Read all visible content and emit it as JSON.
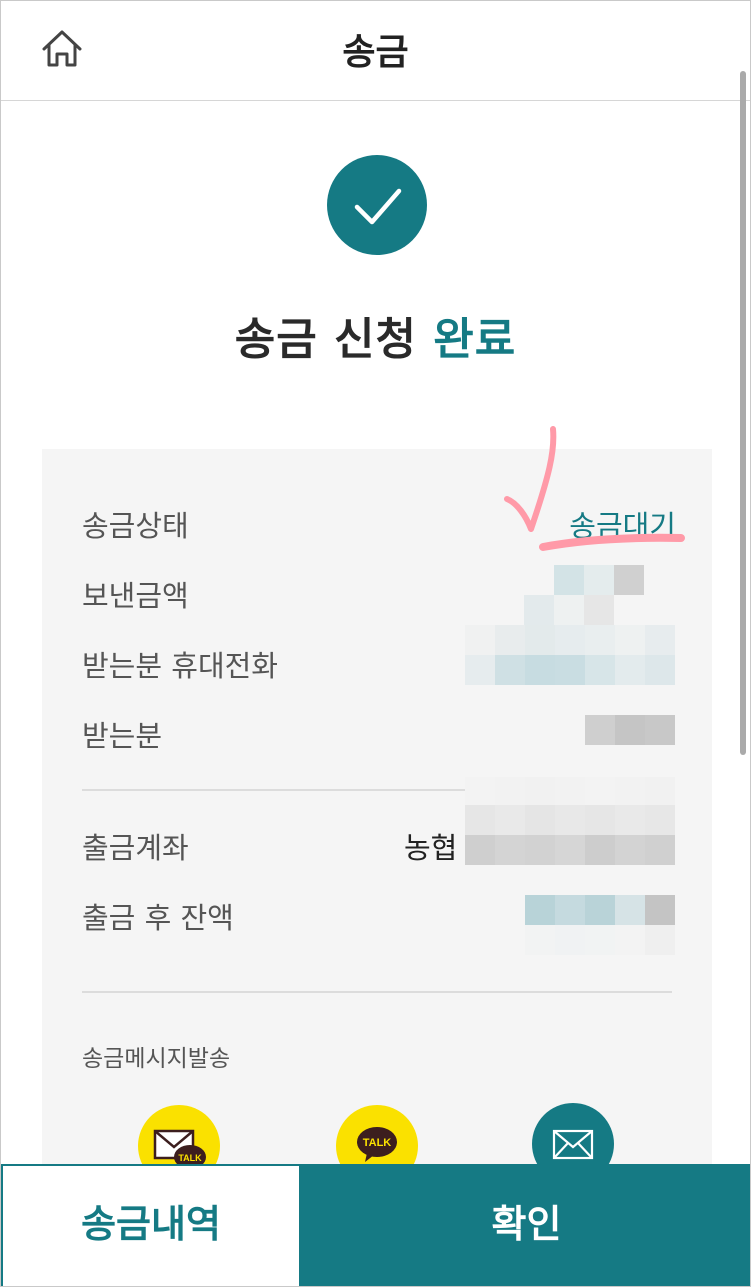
{
  "header": {
    "title": "송금",
    "home_icon": "home-icon"
  },
  "completion": {
    "icon": "check-icon",
    "title_main": "송금 신청",
    "title_accent": "완료"
  },
  "details": {
    "status": {
      "label": "송금상태",
      "value": "송금대기"
    },
    "amount": {
      "label": "보낸금액"
    },
    "recipient_phone": {
      "label": "받는분 휴대전화"
    },
    "recipient": {
      "label": "받는분"
    },
    "withdraw_account": {
      "label": "출금계좌",
      "bank": "농협"
    },
    "balance_after": {
      "label": "출금 후 잔액"
    }
  },
  "message": {
    "label": "송금메시지발송",
    "options": [
      {
        "icon": "kakaotalk-mail-icon",
        "badge": "TALK"
      },
      {
        "icon": "kakaotalk-icon",
        "badge": "TALK"
      },
      {
        "icon": "email-icon"
      }
    ]
  },
  "footer": {
    "history_label": "송금내역",
    "confirm_label": "확인"
  },
  "colors": {
    "accent": "#157a84",
    "kakao_yellow": "#fae100",
    "annotation_pink": "#ff9aa8"
  }
}
